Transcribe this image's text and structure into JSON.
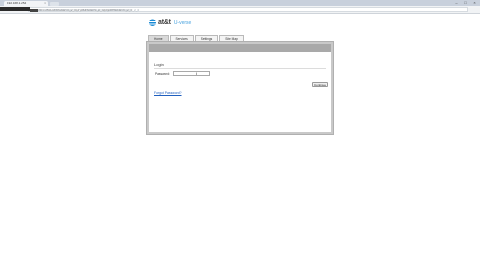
{
  "browser": {
    "tab_title": "192.168.1.254",
    "tab_close": "×",
    "window_buttons": [
      "–",
      "□",
      "×"
    ],
    "nav_buttons": [
      "←",
      "→",
      "⟳"
    ],
    "url": "192.168.1.254/xslt?PAGE=C_2_0&THISPAGE=C_2_0&NEXTPAGE=C_2_0",
    "bookmark_text": "192.168.1.254/xslt?PAGE=C_2_0&THISPAGE=C_2_0&NEXTPAGE=C_2_0"
  },
  "brand": {
    "att_word": "at&t",
    "uverse": "U-verse"
  },
  "tabs": [
    {
      "label": "Home"
    },
    {
      "label": "Services"
    },
    {
      "label": "Settings"
    },
    {
      "label": "Site Map"
    }
  ],
  "login": {
    "title": "Login",
    "password_label": "Password:",
    "password_value": "",
    "cursor_glyph": "I",
    "continue_label": "Continue",
    "forgot_link": "Forgot Password?"
  },
  "colors": {
    "frame_gray": "#c9c9c9",
    "link_blue": "#1f5fbf",
    "uverse_blue": "#4aa3df"
  }
}
